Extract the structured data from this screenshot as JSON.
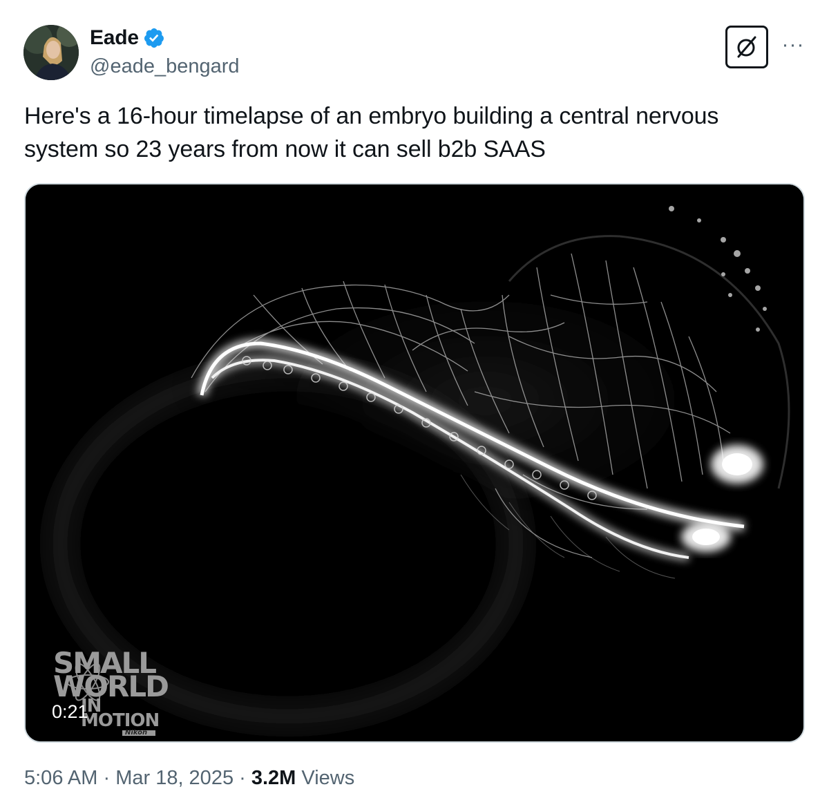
{
  "author": {
    "display_name": "Eade",
    "handle": "@eade_bengard",
    "verified": true,
    "verified_color": "#1d9bf0"
  },
  "actions": {
    "grok_icon": "grok-icon",
    "more_label": "···"
  },
  "tweet": {
    "text": "Here's a 16-hour timelapse of an embryo building a central nervous system so 23 years from now it can sell b2b SAAS"
  },
  "media": {
    "type": "video",
    "duration": "0:21",
    "watermark": {
      "line1": "SMALL",
      "line2": "WORLD",
      "line3": "IN MOTION",
      "brand": "Nikon"
    }
  },
  "meta": {
    "time": "5:06 AM",
    "separator": " · ",
    "date": "Mar 18, 2025",
    "views_count": "3.2M",
    "views_label": " Views"
  },
  "colors": {
    "text_primary": "#0f1419",
    "text_secondary": "#536471",
    "border": "#cfd9de"
  }
}
